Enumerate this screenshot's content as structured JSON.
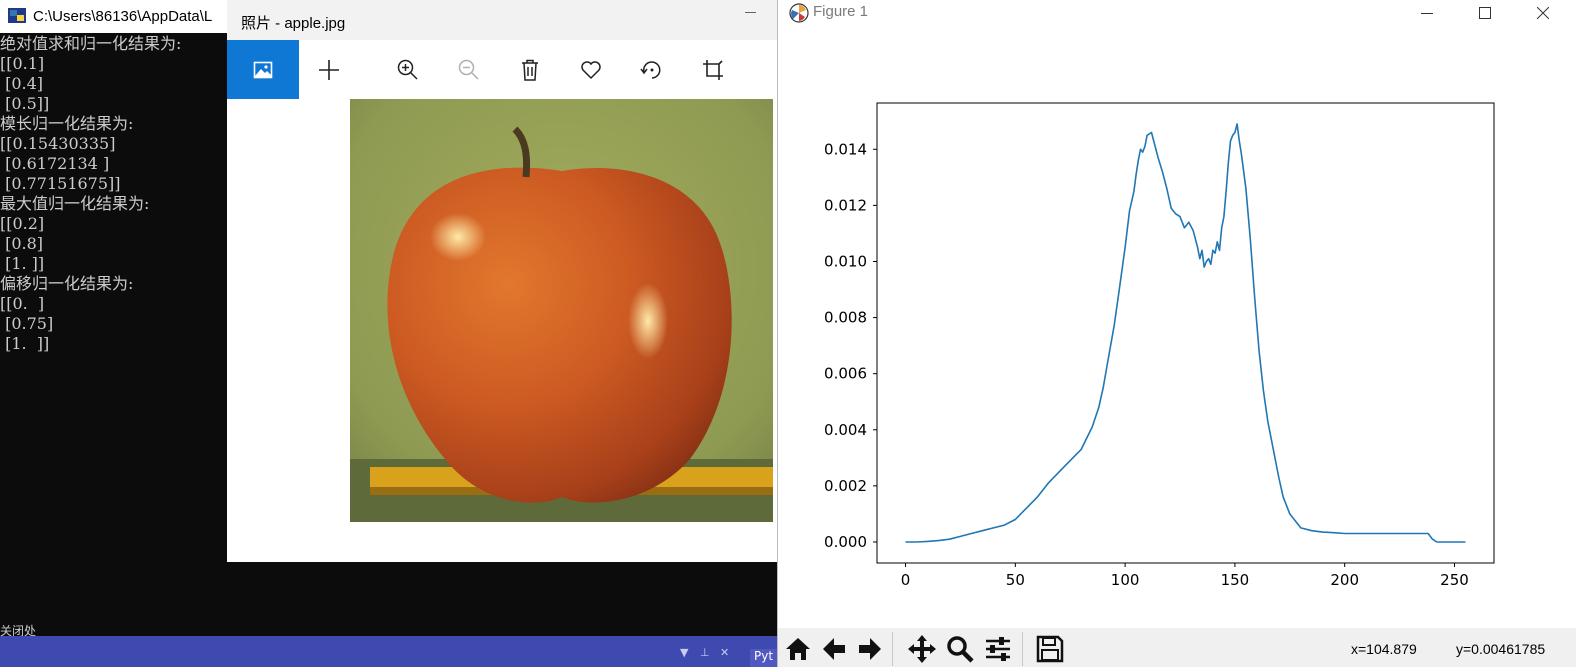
{
  "console": {
    "title": "C:\\Users\\86136\\AppData\\L",
    "output_lines": [
      "绝对值求和归一化结果为:",
      "[[0.1]",
      " [0.4]",
      " [0.5]]",
      "模长归一化结果为:",
      "[[0.15430335]",
      " [0.6172134 ]",
      " [0.77151675]]",
      "最大值归一化结果为:",
      "[[0.2]",
      " [0.8]",
      " [1. ]]",
      "偏移归一化结果为:",
      "[[0.  ]",
      " [0.75]",
      " [1.  ]]"
    ],
    "trailing_text": "关闭处",
    "strip_tab_label": "Pyt",
    "colors": {
      "background": "#0c0c0c",
      "text": "#cccccc",
      "strip": "#3e4ab0"
    }
  },
  "photos": {
    "title": "照片 - apple.jpg",
    "toolbar": [
      {
        "name": "view-photo-icon",
        "active": true
      },
      {
        "name": "add-icon"
      },
      {
        "name": "zoom-in-icon"
      },
      {
        "name": "zoom-out-icon",
        "disabled": true
      },
      {
        "name": "delete-icon"
      },
      {
        "name": "favorite-icon"
      },
      {
        "name": "rotate-icon"
      },
      {
        "name": "crop-icon"
      }
    ],
    "accent": "#0f78d4"
  },
  "figure": {
    "title": "Figure 1",
    "coords": {
      "x": "x=104.879",
      "y": "y=0.00461785"
    },
    "toolbar": [
      "home-icon",
      "back-icon",
      "forward-icon",
      "pan-icon",
      "zoom-icon",
      "configure-subplots-icon",
      "save-icon"
    ]
  },
  "chart_data": {
    "type": "line",
    "title": "",
    "xlabel": "",
    "ylabel": "",
    "xlim": [
      -13,
      268
    ],
    "ylim": [
      -0.00075,
      0.01565
    ],
    "xticks": [
      0,
      50,
      100,
      150,
      200,
      250
    ],
    "yticks": [
      0.0,
      0.002,
      0.004,
      0.006,
      0.008,
      0.01,
      0.012,
      0.014
    ],
    "ytick_labels": [
      "0.000",
      "0.002",
      "0.004",
      "0.006",
      "0.008",
      "0.010",
      "0.012",
      "0.014"
    ],
    "grid": false,
    "series": [
      {
        "color": "#1f77b4",
        "x": [
          0,
          5,
          10,
          15,
          20,
          25,
          30,
          35,
          40,
          45,
          50,
          55,
          60,
          65,
          70,
          75,
          80,
          85,
          88,
          90,
          92,
          95,
          97,
          100,
          102,
          104,
          105,
          106,
          107,
          108,
          109,
          110,
          112,
          115,
          117,
          119,
          121,
          123,
          125,
          127,
          129,
          131,
          133,
          134,
          135,
          136,
          137,
          138,
          139,
          140,
          141,
          142,
          143,
          144,
          145,
          146,
          147,
          148,
          149,
          150,
          151,
          152,
          153,
          155,
          157,
          159,
          161,
          163,
          165,
          168,
          170,
          172,
          175,
          180,
          185,
          190,
          195,
          200,
          210,
          220,
          230,
          238,
          240,
          242,
          245,
          250,
          255
        ],
        "y": [
          0.0,
          0.0,
          2e-05,
          5e-05,
          0.0001,
          0.0002,
          0.0003,
          0.0004,
          0.0005,
          0.0006,
          0.0008,
          0.0012,
          0.0016,
          0.0021,
          0.0025,
          0.0029,
          0.0033,
          0.0041,
          0.0048,
          0.0055,
          0.0064,
          0.0077,
          0.0088,
          0.0105,
          0.0118,
          0.0125,
          0.0131,
          0.0136,
          0.014,
          0.0139,
          0.0141,
          0.0145,
          0.0146,
          0.0137,
          0.0132,
          0.0126,
          0.0119,
          0.0117,
          0.0116,
          0.0112,
          0.0114,
          0.0111,
          0.0105,
          0.0101,
          0.0104,
          0.0098,
          0.01,
          0.0101,
          0.0099,
          0.0104,
          0.0103,
          0.0107,
          0.0104,
          0.0112,
          0.0116,
          0.0125,
          0.0135,
          0.0143,
          0.0145,
          0.0146,
          0.0149,
          0.0143,
          0.0138,
          0.0126,
          0.0108,
          0.0087,
          0.0068,
          0.0054,
          0.0043,
          0.0031,
          0.0023,
          0.0016,
          0.001,
          0.0005,
          0.0004,
          0.00035,
          0.00033,
          0.0003,
          0.0003,
          0.0003,
          0.0003,
          0.0003,
          0.0001,
          0.0,
          0.0,
          0.0,
          0.0
        ]
      }
    ]
  }
}
